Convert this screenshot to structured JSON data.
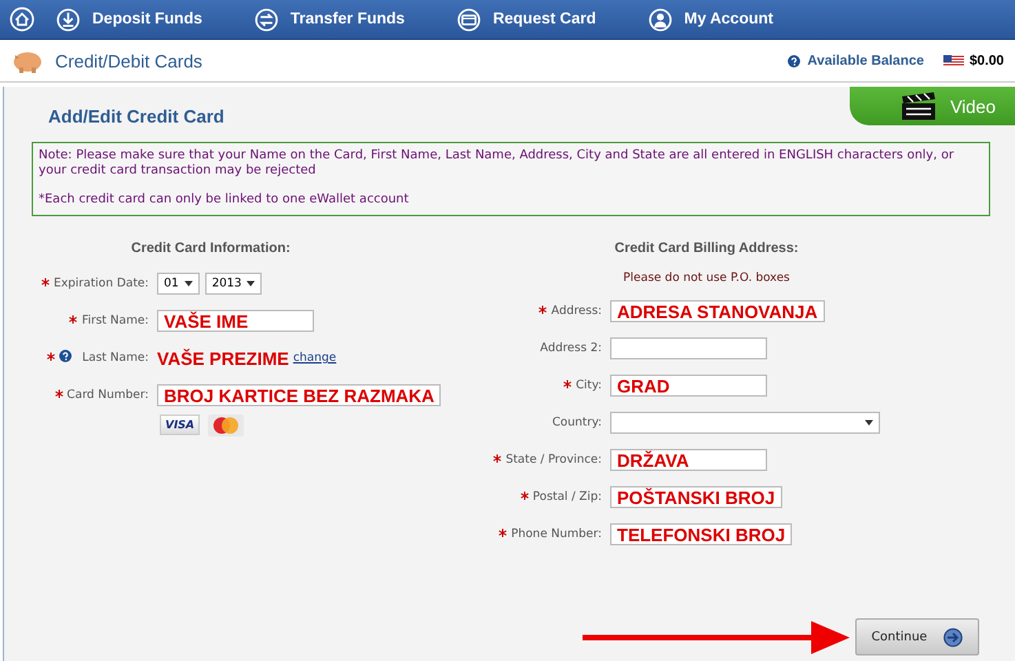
{
  "nav": {
    "items": [
      {
        "label": "Deposit Funds"
      },
      {
        "label": "Transfer Funds"
      },
      {
        "label": "Request Card"
      },
      {
        "label": "My Account"
      }
    ]
  },
  "header": {
    "title": "Credit/Debit Cards",
    "balance_label": "Available Balance",
    "balance": "$0.00"
  },
  "panel": {
    "title": "Add/Edit Credit Card",
    "video_tab": "Video"
  },
  "note": {
    "lines": [
      "Note: Please make sure that your Name on the Card, First Name, Last Name, Address, City and State are all entered in ENGLISH characters only, or your credit card transaction may be rejected",
      "*Each credit card can only be linked to one eWallet account"
    ]
  },
  "card_info": {
    "heading": "Credit Card Information:",
    "fields": [
      {
        "kind": "selects",
        "label": "Expiration Date:",
        "required": true,
        "values": [
          "01",
          "2013"
        ]
      },
      {
        "kind": "text",
        "label": "First Name:",
        "required": true,
        "value": "VAŠE IME"
      },
      {
        "kind": "static",
        "label": "Last Name:",
        "required": true,
        "help": true,
        "value": "VAŠE PREZIME",
        "link": "change"
      },
      {
        "kind": "text",
        "label": "Card Number:",
        "required": true,
        "value": "BROJ KARTICE BEZ RAZMAKA"
      },
      {
        "kind": "logos",
        "logos": [
          {
            "kind": "visa",
            "text": "VISA"
          },
          {
            "kind": "mastercard"
          }
        ]
      }
    ]
  },
  "billing": {
    "heading": "Credit Card Billing Address:",
    "hint": "Please do not use P.O. boxes",
    "fields": [
      {
        "kind": "text",
        "label": "Address:",
        "required": true,
        "value": "ADRESA STANOVANJA"
      },
      {
        "kind": "text",
        "label": "Address 2:",
        "required": false
      },
      {
        "kind": "text",
        "label": "City:",
        "required": true,
        "value": "GRAD"
      },
      {
        "kind": "dropdown",
        "label": "Country:",
        "required": false
      },
      {
        "kind": "text",
        "label": "State / Province:",
        "required": true,
        "value": "DRŽAVA"
      },
      {
        "kind": "text",
        "label": "Postal / Zip:",
        "required": true,
        "value": "POŠTANSKI BROJ"
      },
      {
        "kind": "text",
        "label": "Phone Number:",
        "required": true,
        "value": "TELEFONSKI BROJ"
      }
    ]
  },
  "continue_button": "Continue"
}
